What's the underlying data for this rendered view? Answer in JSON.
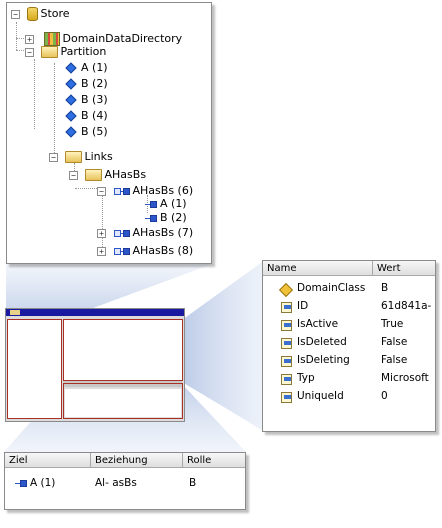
{
  "tree": {
    "store": "Store",
    "domain_data_directory": "DomainDataDirectory",
    "partition": "Partition",
    "elements": [
      "A (1)",
      "B (2)",
      "B (3)",
      "B (4)",
      "B (5)"
    ],
    "links": "Links",
    "ahasbs_folder": "AHasBs",
    "link_6": "AHasBs (6)",
    "link_6_children": [
      "A (1)",
      "B (2)"
    ],
    "link_7": "AHasBs (7)",
    "link_8": "AHasBs (8)",
    "expander_collapsed": "+",
    "expander_expanded": "−"
  },
  "properties": {
    "headers": {
      "name": "Name",
      "value": "Wert"
    },
    "rows": [
      {
        "name": "DomainClass",
        "value": "B",
        "icon": "key-icon"
      },
      {
        "name": "ID",
        "value": "61d841a-",
        "icon": "property-icon"
      },
      {
        "name": "IsActive",
        "value": "True",
        "icon": "property-icon"
      },
      {
        "name": "IsDeleted",
        "value": "False",
        "icon": "property-icon"
      },
      {
        "name": "IsDeleting",
        "value": "False",
        "icon": "property-icon"
      },
      {
        "name": "Typ",
        "value": "Microsoft",
        "icon": "property-icon"
      },
      {
        "name": "UniqueId",
        "value": "0",
        "icon": "property-icon"
      }
    ]
  },
  "roles": {
    "headers": {
      "target": "Ziel",
      "relation": "Beziehung",
      "role": "Rolle"
    },
    "row": {
      "target": "A (1)",
      "relation": "Al- asBs",
      "role": "B"
    }
  },
  "colors": {
    "highlight": "#a83025",
    "window_title": "#1a1aa0",
    "panel_border": "#8a8a8a"
  }
}
